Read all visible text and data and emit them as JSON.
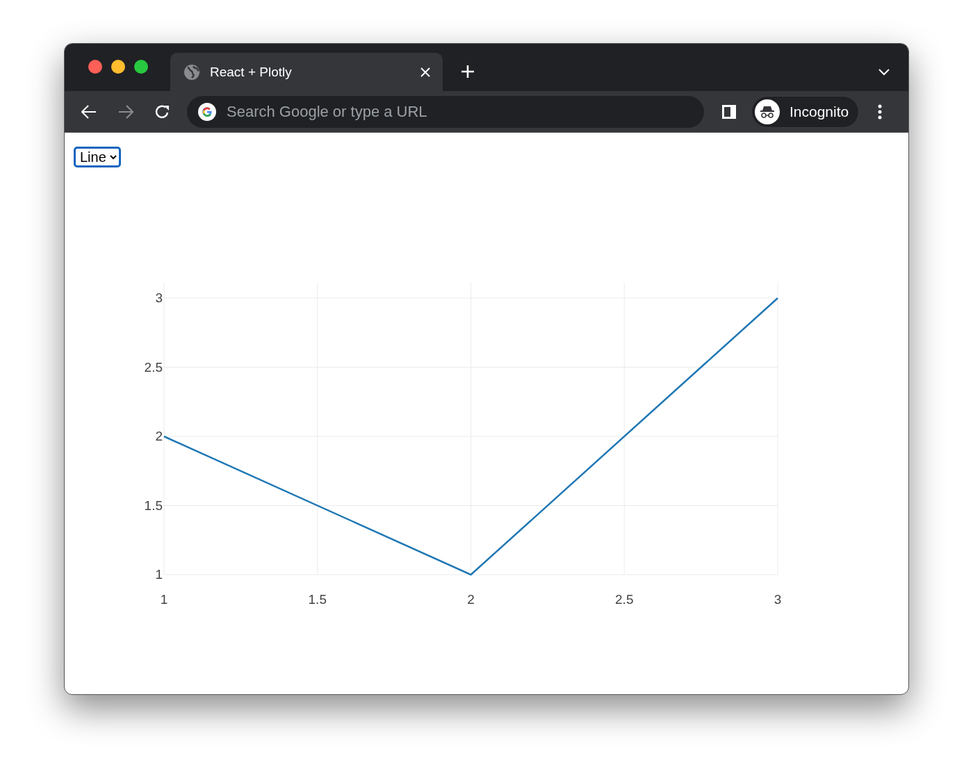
{
  "window": {
    "tab_title": "React + Plotly",
    "address_placeholder": "Search Google or type a URL",
    "profile": "Incognito"
  },
  "chart_type_select": {
    "value": "Line"
  },
  "chart_data": {
    "type": "line",
    "x": [
      1,
      2,
      3
    ],
    "series": [
      {
        "color": "#1f77b4",
        "values": [
          2,
          1,
          3
        ]
      }
    ],
    "grid": true,
    "xlim": [
      1,
      3
    ],
    "ylim": [
      1,
      3
    ],
    "xticks": [
      1,
      1.5,
      2,
      2.5,
      3
    ],
    "yticks": [
      1,
      1.5,
      2,
      2.5,
      3
    ]
  }
}
